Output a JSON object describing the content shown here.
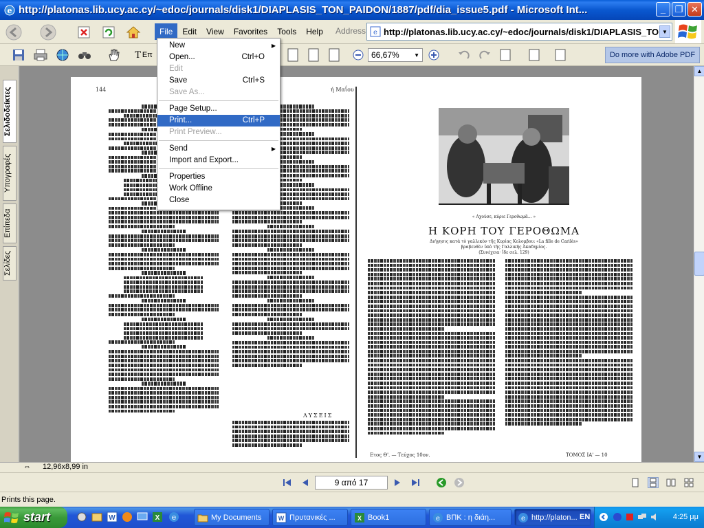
{
  "window": {
    "title": "http://platonas.lib.ucy.ac.cy/~edoc/journals/disk1/DIAPLASIS_TON_PAIDON/1887/pdf/dia_issue5.pdf - Microsoft Int...",
    "minimize": "_",
    "maximize": "❐",
    "close": "✕"
  },
  "menubar": {
    "items": [
      "File",
      "Edit",
      "View",
      "Favorites",
      "Tools",
      "Help"
    ]
  },
  "address": {
    "label": "Address",
    "url": "http://platonas.lib.ucy.ac.cy/~edoc/journals/disk1/DIAPLASIS_TON_PAIDON/1887/pdf/dia_issue5.pdf"
  },
  "pdf_toolbar": {
    "select_text_label": "Επ",
    "zoom": "66,67%",
    "adobe_button": "Do more with Adobe PDF"
  },
  "left_tabs": [
    "Σελιδοδείκτες",
    "Υπογραφές",
    "Επίπεδα",
    "Σελίδες"
  ],
  "file_menu": {
    "items": [
      {
        "label": "New",
        "shortcut": "",
        "submenu": true,
        "disabled": false
      },
      {
        "label": "Open...",
        "shortcut": "Ctrl+O",
        "submenu": false,
        "disabled": false
      },
      {
        "label": "Edit",
        "shortcut": "",
        "submenu": false,
        "disabled": true
      },
      {
        "label": "Save",
        "shortcut": "Ctrl+S",
        "submenu": false,
        "disabled": false
      },
      {
        "label": "Save As...",
        "shortcut": "",
        "submenu": false,
        "disabled": true
      },
      {
        "sep": true
      },
      {
        "label": "Page Setup...",
        "shortcut": "",
        "submenu": false,
        "disabled": false
      },
      {
        "label": "Print...",
        "shortcut": "Ctrl+P",
        "submenu": false,
        "disabled": false,
        "highlighted": true
      },
      {
        "label": "Print Preview...",
        "shortcut": "",
        "submenu": false,
        "disabled": true
      },
      {
        "sep": true
      },
      {
        "label": "Send",
        "shortcut": "",
        "submenu": true,
        "disabled": false
      },
      {
        "label": "Import and Export...",
        "shortcut": "",
        "submenu": false,
        "disabled": false
      },
      {
        "sep": true
      },
      {
        "label": "Properties",
        "shortcut": "",
        "submenu": false,
        "disabled": false
      },
      {
        "label": "Work Offline",
        "shortcut": "",
        "submenu": false,
        "disabled": false
      },
      {
        "label": "Close",
        "shortcut": "",
        "submenu": false,
        "disabled": false
      }
    ]
  },
  "document": {
    "left_page_number": "144",
    "left_header_right": "ή Μαΐου",
    "lyseis": "ΛΥΣΕΙΣ",
    "illustration_caption": "« Αχούσε, κύριε Γεροθωμᾶ... »",
    "story_title": "Η ΚΟΡΗ ΤΟΥ ΓΕΡΟΘΩΜΑ",
    "story_subtitle_1": "Διήγησις κατὰ τὸ γαλλικὸν τῆς Κυρίας Κολομβου: «La fille de Carilès»",
    "story_subtitle_2": "βραβευθὲν ὑπὸ τῆς Γαλλικῆς Ἀκαδημίας.",
    "story_subtitle_3": "(Συνέχεια· ἴδε σελ. 129)",
    "footer_left": "Ετος Θ'. — Τεύχος 10ον.",
    "footer_right": "ΤΟΜΟΣ ΙΑ' — 10"
  },
  "status": {
    "page_size": "12,96x8,99 in",
    "page_indicator": "9 από 17",
    "ie_status": "Prints this page."
  },
  "taskbar": {
    "start_label": "start",
    "tasks": [
      {
        "label": "My Documents",
        "active": false
      },
      {
        "label": "Πρυτανικές ...",
        "active": false
      },
      {
        "label": "Book1",
        "active": false
      },
      {
        "label": "ΒΠΚ : η διάη...",
        "active": false
      },
      {
        "label": "http://platon...",
        "active": true
      }
    ],
    "language": "EN",
    "clock": "4:25 μμ"
  }
}
